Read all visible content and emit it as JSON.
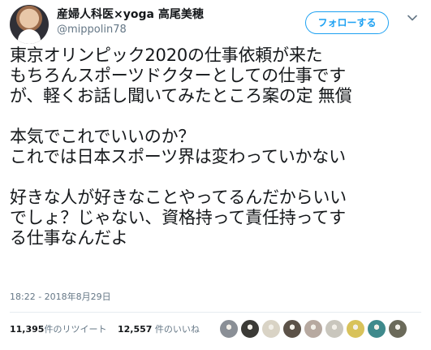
{
  "user": {
    "display_name": "産婦人科医×yoga 高尾美穂",
    "handle": "@mippolin78"
  },
  "follow_button": {
    "label": "フォローする"
  },
  "tweet": {
    "paragraphs": [
      [
        "東京オリンピック2020の仕事依頼が来た",
        "もちろんスポーツドクターとしての仕事です",
        "が、軽くお話し聞いてみたところ案の定 無償"
      ],
      [
        "本気でこれでいいのか？",
        "これでは日本スポーツ界は変わっていかない"
      ],
      [
        "好きな人が好きなことやってるんだからいい",
        "でしょ？じゃない、資格持って責任持ってす",
        "る仕事なんだよ"
      ]
    ],
    "timestamp": "18:22 - 2018年8月29日"
  },
  "stats": {
    "retweets_count": "11,395",
    "retweets_label": "件のリツイート",
    "likes_count": "12,557",
    "likes_label": " 件のいいね"
  },
  "likers": {
    "avatars": [
      {
        "icon": "liker-avatar",
        "color": "#8a8f96"
      },
      {
        "icon": "liker-avatar",
        "color": "#3b3a36"
      },
      {
        "icon": "liker-avatar",
        "color": "#d9d3c5"
      },
      {
        "icon": "liker-avatar",
        "color": "#5c5248"
      },
      {
        "icon": "liker-avatar",
        "color": "#b7a9a0"
      },
      {
        "icon": "liker-avatar",
        "color": "#c9c6bd"
      },
      {
        "icon": "liker-avatar",
        "color": "#d8c25a"
      },
      {
        "icon": "liker-avatar",
        "color": "#3f8a8c"
      },
      {
        "icon": "liker-avatar",
        "color": "#6b6a5a"
      }
    ]
  },
  "colors": {
    "accent": "#1da1f2",
    "text": "#14171a",
    "secondary": "#657786",
    "divider": "#e6ecf0"
  }
}
